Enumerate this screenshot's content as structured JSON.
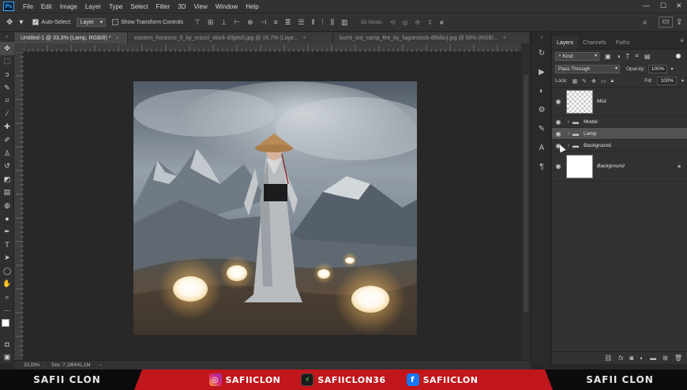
{
  "app": {
    "logo": "Ps",
    "menu": [
      "File",
      "Edit",
      "Image",
      "Layer",
      "Type",
      "Select",
      "Filter",
      "3D",
      "View",
      "Window",
      "Help"
    ],
    "window_controls": {
      "minimize": "—",
      "maximize": "☐",
      "close": "✕"
    }
  },
  "options_bar": {
    "auto_select_label": "Auto-Select:",
    "auto_select_value": "Layer",
    "show_transform_label": "Show Transform Controls",
    "mode_3d_label": "3D Mode:"
  },
  "tabs": [
    {
      "label": "Untitled-1 @ 33,3% (Lamp, RGB/8) *"
    },
    {
      "label": "eastern_horizons_5_by_mizzd_stock-d3jptv5.jpg @ 16,7% (Laye..."
    },
    {
      "label": "burnt_out_camp_fire_by_faguestock-d6klbcj.jpg @ 50% (RGB/..."
    }
  ],
  "status": {
    "zoom": "33,33%",
    "doc": "Doc: 7,19M/41,1M"
  },
  "layers_panel": {
    "tabs": [
      "Layers",
      "Channels",
      "Paths"
    ],
    "filter_kind": "Kind",
    "blend_mode": "Pass Through",
    "opacity_label": "Opacity:",
    "opacity_value": "100%",
    "lock_label": "Lock:",
    "fill_label": "Fill:",
    "fill_value": "100%",
    "layers": [
      {
        "name": "Mist",
        "type": "pixel"
      },
      {
        "name": "Model",
        "type": "group"
      },
      {
        "name": "Lamp",
        "type": "group",
        "selected": true
      },
      {
        "name": "Background",
        "type": "group"
      },
      {
        "name": "Background",
        "type": "background"
      }
    ],
    "footer_fx": "fx"
  },
  "banner": {
    "left": "SAFII CLON",
    "instagram": "SAFIICLON",
    "other": "SAFIICLON36",
    "facebook": "SAFIICLON",
    "right": "SAFII CLON"
  },
  "colors": {
    "accent": "#31a8ff",
    "banner_red": "#c0161c"
  }
}
